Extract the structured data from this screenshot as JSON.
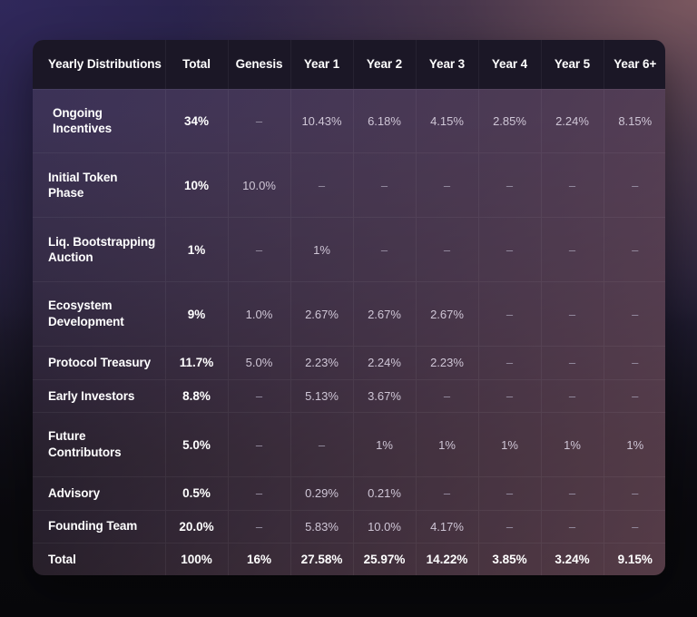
{
  "table": {
    "columns": [
      "Yearly Distributions",
      "Total",
      "Genesis",
      "Year 1",
      "Year 2",
      "Year 3",
      "Year 4",
      "Year 5",
      "Year 6+"
    ],
    "dash": "–",
    "rows": [
      {
        "label": "Ongoing Incentives",
        "indented": true,
        "cells": [
          "34%",
          "–",
          "10.43%",
          "6.18%",
          "4.15%",
          "2.85%",
          "2.24%",
          "8.15%"
        ]
      },
      {
        "label": "Initial Token Phase",
        "indented": false,
        "cells": [
          "10%",
          "10.0%",
          "–",
          "–",
          "–",
          "–",
          "–",
          "–"
        ]
      },
      {
        "label": "Liq. Bootstrapping Auction",
        "indented": false,
        "cells": [
          "1%",
          "–",
          "1%",
          "–",
          "–",
          "–",
          "–",
          "–"
        ]
      },
      {
        "label": "Ecosystem Development",
        "indented": false,
        "cells": [
          "9%",
          "1.0%",
          "2.67%",
          "2.67%",
          "2.67%",
          "–",
          "–",
          "–"
        ]
      },
      {
        "label": "Protocol Treasury",
        "indented": false,
        "cells": [
          "11.7%",
          "5.0%",
          "2.23%",
          "2.24%",
          "2.23%",
          "–",
          "–",
          "–"
        ]
      },
      {
        "label": "Early Investors",
        "indented": false,
        "cells": [
          "8.8%",
          "–",
          "5.13%",
          "3.67%",
          "–",
          "–",
          "–",
          "–"
        ]
      },
      {
        "label": "Future Contributors",
        "indented": false,
        "cells": [
          "5.0%",
          "–",
          "–",
          "1%",
          "1%",
          "1%",
          "1%",
          "1%"
        ]
      },
      {
        "label": "Advisory",
        "indented": false,
        "cells": [
          "0.5%",
          "–",
          "0.29%",
          "0.21%",
          "–",
          "–",
          "–",
          "–"
        ]
      },
      {
        "label": "Founding Team",
        "indented": false,
        "cells": [
          "20.0%",
          "–",
          "5.83%",
          "10.0%",
          "4.17%",
          "–",
          "–",
          "–"
        ]
      },
      {
        "label": "Total",
        "indented": false,
        "is_total": true,
        "cells": [
          "100%",
          "16%",
          "27.58%",
          "25.97%",
          "14.22%",
          "3.85%",
          "3.24%",
          "9.15%"
        ]
      }
    ]
  },
  "colors": {
    "header_bg": "#1b1726",
    "card_top": "#3b3259",
    "card_bottom": "#121119",
    "text_primary": "#ffffff",
    "text_secondary": "#cfc6d6",
    "page_bg": "#0a0a0e"
  }
}
